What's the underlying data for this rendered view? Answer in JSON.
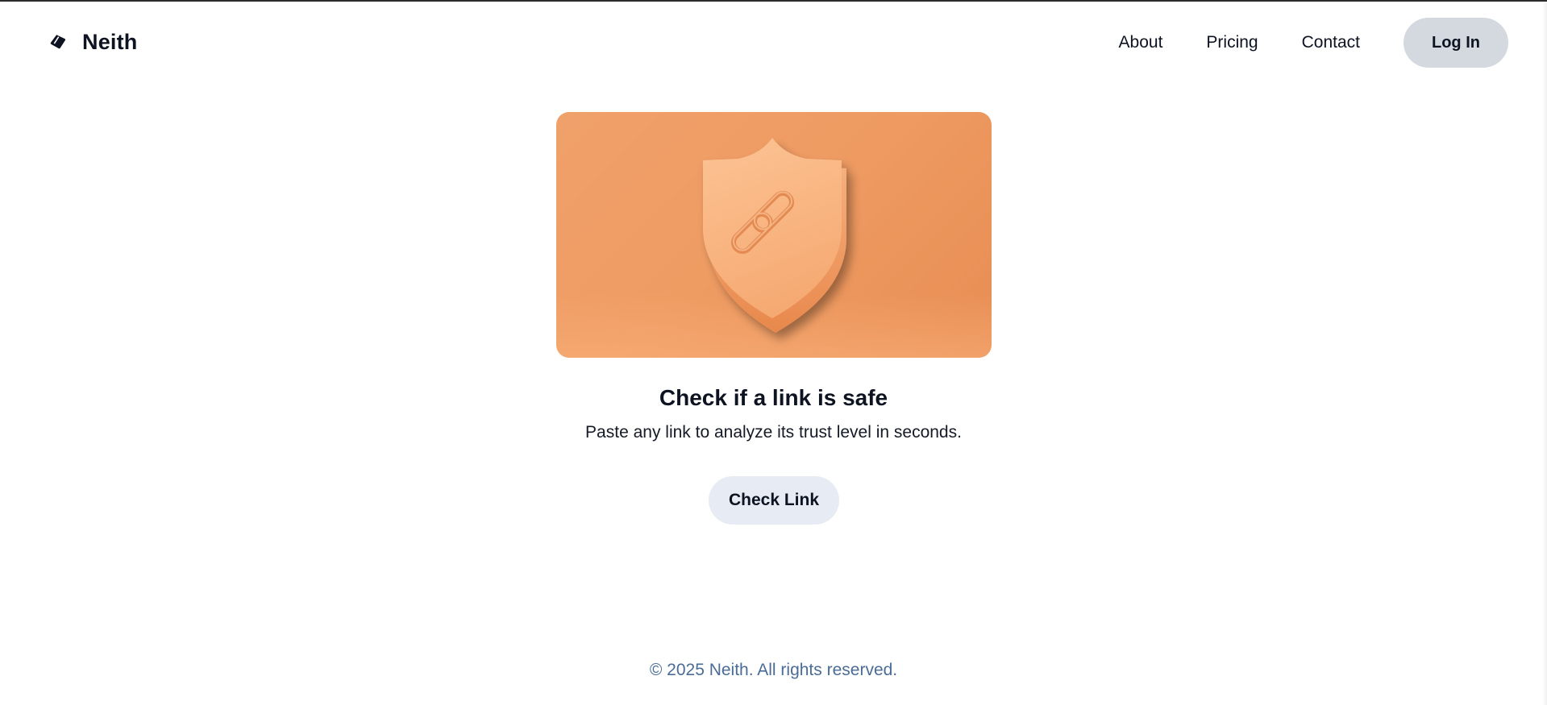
{
  "header": {
    "brand_name": "Neith",
    "brand_icon": "neith-logo-icon",
    "nav": [
      {
        "label": "About"
      },
      {
        "label": "Pricing"
      },
      {
        "label": "Contact"
      }
    ],
    "login_label": "Log In"
  },
  "hero": {
    "illustration": "shield-link-icon",
    "title": "Check if a link is safe",
    "subtitle": "Paste any link to analyze its trust level in seconds.",
    "cta_label": "Check Link"
  },
  "footer": {
    "copyright": "© 2025 Neith. All rights reserved."
  },
  "colors": {
    "accent": "#f0a06a",
    "login_bg": "#d4d9df",
    "cta_bg": "#e7ebf3",
    "footer_text": "#4a6c96"
  }
}
